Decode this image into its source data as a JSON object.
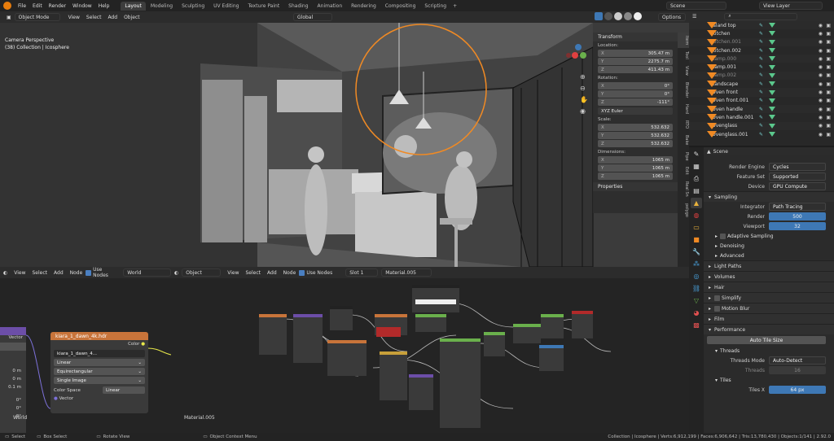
{
  "topbar": {
    "menus": [
      "File",
      "Edit",
      "Render",
      "Window",
      "Help"
    ],
    "workspaces": [
      "Layout",
      "Modeling",
      "Sculpting",
      "UV Editing",
      "Texture Paint",
      "Shading",
      "Animation",
      "Rendering",
      "Compositing",
      "Scripting"
    ],
    "active_workspace": "Layout",
    "scene": "Scene",
    "view_layer": "View Layer"
  },
  "viewport": {
    "mode": "Object Mode",
    "menus": [
      "View",
      "Select",
      "Add",
      "Object"
    ],
    "orientation": "Global",
    "options_label": "Options",
    "overlay_line1": "Camera Perspective",
    "overlay_line2": "(38) Collection | Icosphere"
  },
  "npanel": {
    "transform_title": "Transform",
    "location_label": "Location:",
    "location": [
      {
        "k": "X",
        "v": "305.47 m"
      },
      {
        "k": "Y",
        "v": "2275.7 m"
      },
      {
        "k": "Z",
        "v": "411.43 m"
      }
    ],
    "rotation_label": "Rotation:",
    "rotation": [
      {
        "k": "X",
        "v": "0°"
      },
      {
        "k": "Y",
        "v": "0°"
      },
      {
        "k": "Z",
        "v": "-111°"
      }
    ],
    "rotation_mode": "XYZ Euler",
    "scale_label": "Scale:",
    "scale": [
      {
        "k": "X",
        "v": "532.632"
      },
      {
        "k": "Y",
        "v": "532.632"
      },
      {
        "k": "Z",
        "v": "532.632"
      }
    ],
    "dimensions_label": "Dimensions:",
    "dimensions": [
      {
        "k": "X",
        "v": "1065 m"
      },
      {
        "k": "Y",
        "v": "1065 m"
      },
      {
        "k": "Z",
        "v": "1065 m"
      }
    ],
    "properties_title": "Properties",
    "tabs": [
      "Item",
      "Tool",
      "View",
      "Blender",
      "Hard",
      "RTO",
      "Bake",
      "Pipe",
      "Edit",
      "Real Sn",
      "polygo"
    ]
  },
  "outliner": {
    "rows": [
      {
        "name": "Island top",
        "dim": false
      },
      {
        "name": "Kitchen",
        "dim": false
      },
      {
        "name": "Kitchen.001",
        "dim": true
      },
      {
        "name": "Kitchen.002",
        "dim": false
      },
      {
        "name": "Lamp.000",
        "dim": true
      },
      {
        "name": "Lamp.001",
        "dim": false
      },
      {
        "name": "Lamp.002",
        "dim": true
      },
      {
        "name": "Landscape",
        "dim": false
      },
      {
        "name": "Oven front",
        "dim": false
      },
      {
        "name": "Oven front.001",
        "dim": false
      },
      {
        "name": "Oven handle",
        "dim": false
      },
      {
        "name": "Oven handle.001",
        "dim": false
      },
      {
        "name": "Ovenglass",
        "dim": false
      },
      {
        "name": "Ovenglass.001",
        "dim": false
      }
    ]
  },
  "properties": {
    "context": "Scene",
    "render_engine_label": "Render Engine",
    "render_engine": "Cycles",
    "feature_set_label": "Feature Set",
    "feature_set": "Supported",
    "device_label": "Device",
    "device": "GPU Compute",
    "sampling": "Sampling",
    "integrator_label": "Integrator",
    "integrator": "Path Tracing",
    "render_label": "Render",
    "render_samples": "500",
    "viewport_label": "Viewport",
    "viewport_samples": "32",
    "adaptive_sampling": "Adaptive Sampling",
    "denoising": "Denoising",
    "advanced": "Advanced",
    "light_paths": "Light Paths",
    "volumes": "Volumes",
    "hair": "Hair",
    "simplify": "Simplify",
    "motion_blur": "Motion Blur",
    "film": "Film",
    "performance": "Performance",
    "auto_tile_size": "Auto Tile Size",
    "threads": "Threads",
    "threads_mode_label": "Threads Mode",
    "threads_mode": "Auto-Detect",
    "threads_label": "Threads",
    "threads_value": "16",
    "tiles": "Tiles",
    "tiles_x_label": "Tiles X",
    "tiles_x": "64 px"
  },
  "node_left": {
    "menus": [
      "View",
      "Select",
      "Add",
      "Node"
    ],
    "use_nodes": "Use Nodes",
    "world": "World",
    "node_title": "kiara_1_dawn_4k.hdr",
    "color_out": "Color",
    "image_name": "kiara_1_dawn_4...",
    "interpolation": "Linear",
    "projection": "Equirectangular",
    "source": "Single Image",
    "color_space_label": "Color Space",
    "color_space": "Linear",
    "vector_in": "Vector",
    "left_node_label": "Vector",
    "left_values": [
      "0 m",
      "0 m",
      "0.1 m",
      "0°",
      "0°",
      "0°"
    ],
    "world_label": "World"
  },
  "node_right": {
    "mode": "Object",
    "menus": [
      "View",
      "Select",
      "Add",
      "Node"
    ],
    "use_nodes": "Use Nodes",
    "slot": "Slot 1",
    "material": "Material.005",
    "material_label": "Material.005"
  },
  "statusbar": {
    "select": "Select",
    "box_select": "Box Select",
    "rotate_view": "Rotate View",
    "context_menu": "Object Context Menu",
    "stats": "Collection | Icosphere | Verts:6,912,199 | Faces:6,906,642 | Tris:13,780,430 | Objects:1/141 | 2.92.0"
  }
}
